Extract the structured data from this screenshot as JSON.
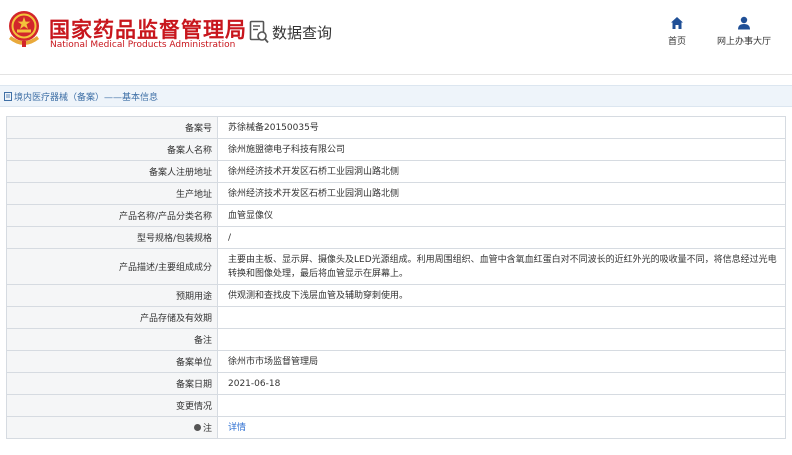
{
  "header": {
    "agency_cn": "国家药品监督管理局",
    "agency_en": "National Medical Products Administration",
    "query_title": "数据查询",
    "brand_color": "#c8161d"
  },
  "nav": {
    "home_label": "首页",
    "office_label": "网上办事大厅",
    "home_icon": "home-icon",
    "office_icon": "user-icon"
  },
  "breadcrumb": {
    "text": "境内医疗器械（备案）——基本信息"
  },
  "record": {
    "rows": [
      {
        "label": "备案号",
        "value": "苏徐械备20150035号"
      },
      {
        "label": "备案人名称",
        "value": "徐州施盟德电子科技有限公司"
      },
      {
        "label": "备案人注册地址",
        "value": "徐州经济技术开发区石桥工业园洞山路北侧"
      },
      {
        "label": "生产地址",
        "value": "徐州经济技术开发区石桥工业园洞山路北侧"
      },
      {
        "label": "产品名称/产品分类名称",
        "value": "血管显像仪"
      },
      {
        "label": "型号规格/包装规格",
        "value": "/"
      },
      {
        "label": "产品描述/主要组成成分",
        "value": "主要由主板、显示屏、摄像头及LED光源组成。利用周围组织、血管中含氧血红蛋白对不同波长的近红外光的吸收量不同，将信息经过光电转换和图像处理，最后将血管显示在屏幕上。"
      },
      {
        "label": "预期用途",
        "value": "供观测和查找皮下浅层血管及辅助穿刺使用。"
      },
      {
        "label": "产品存储及有效期",
        "value": ""
      },
      {
        "label": "备注",
        "value": ""
      },
      {
        "label": "备案单位",
        "value": "徐州市市场监督管理局"
      },
      {
        "label": "备案日期",
        "value": "2021-06-18"
      },
      {
        "label": "变更情况",
        "value": ""
      }
    ],
    "note_label": "注",
    "note_link": "详情"
  }
}
